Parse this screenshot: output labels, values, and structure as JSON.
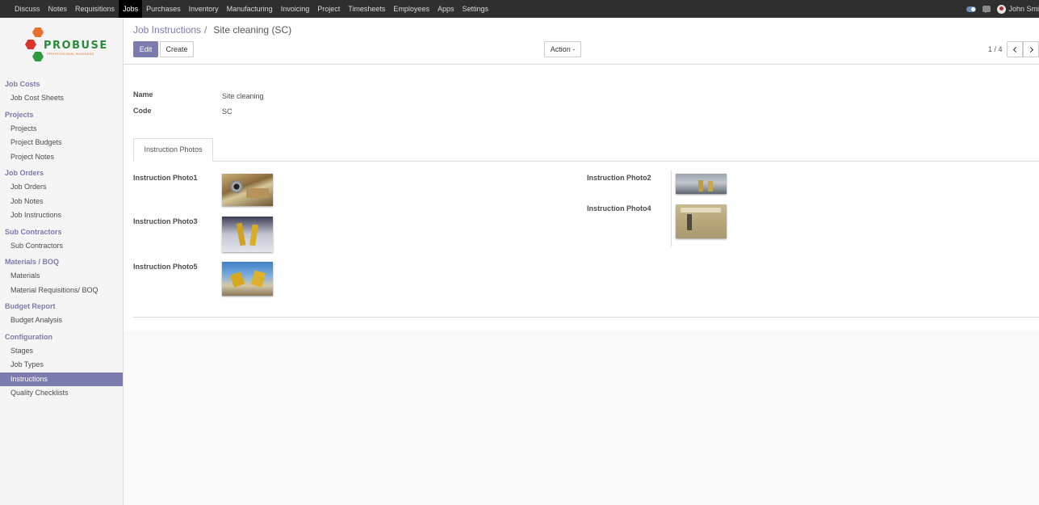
{
  "topnav": {
    "items": [
      "Discuss",
      "Notes",
      "Requisitions",
      "Jobs",
      "Purchases",
      "Inventory",
      "Manufacturing",
      "Invoicing",
      "Project",
      "Timesheets",
      "Employees",
      "Apps",
      "Settings"
    ],
    "active": "Jobs",
    "user_name": "John Smi"
  },
  "logo": {
    "word": "PROBUSE",
    "tagline": "PROFESSIONAL BUSINESS"
  },
  "sidebar": {
    "sections": [
      {
        "title": "Job Costs",
        "items": [
          "Job Cost Sheets"
        ]
      },
      {
        "title": "Projects",
        "items": [
          "Projects",
          "Project Budgets",
          "Project Notes"
        ]
      },
      {
        "title": "Job Orders",
        "items": [
          "Job Orders",
          "Job Notes",
          "Job Instructions"
        ]
      },
      {
        "title": "Sub Contractors",
        "items": [
          "Sub Contractors"
        ]
      },
      {
        "title": "Materials / BOQ",
        "items": [
          "Materials",
          "Material Requisitions/ BOQ"
        ]
      },
      {
        "title": "Budget Report",
        "items": [
          "Budget Analysis"
        ]
      },
      {
        "title": "Configuration",
        "items": [
          "Stages",
          "Job Types",
          "Instructions",
          "Quality Checklists"
        ]
      }
    ],
    "active_item": "Instructions"
  },
  "breadcrumb": {
    "parent": "Job Instructions",
    "separator": "/",
    "current": "Site cleaning (SC)"
  },
  "buttons": {
    "edit": "Edit",
    "create": "Create",
    "action": "Action -"
  },
  "pager": {
    "text": "1 / 4"
  },
  "form": {
    "name_label": "Name",
    "name_value": "Site cleaning",
    "code_label": "Code",
    "code_value": "SC",
    "tab_label": "Instruction Photos",
    "photo_labels": {
      "photo1": "Instruction Photo1",
      "photo2": "Instruction Photo2",
      "photo3": "Instruction Photo3",
      "photo4": "Instruction Photo4",
      "photo5": "Instruction Photo5"
    }
  },
  "colors": {
    "accent": "#7c7bad",
    "topbar": "#2f2f2f"
  }
}
